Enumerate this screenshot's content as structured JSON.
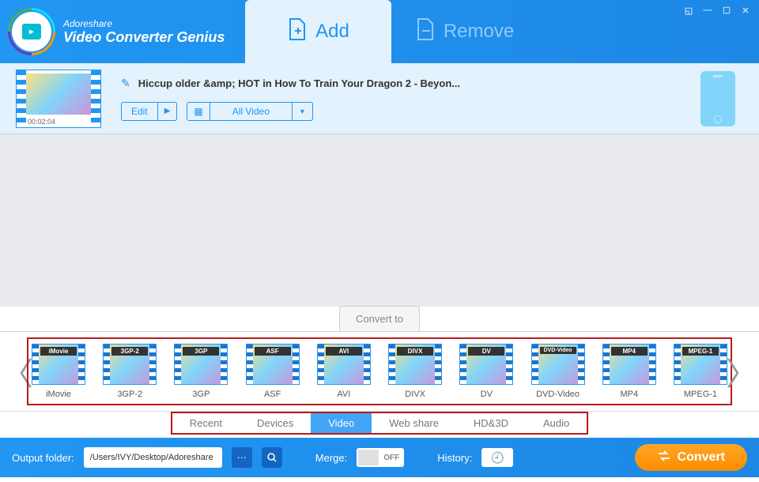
{
  "brand": {
    "name": "Adoreshare",
    "product": "Video Converter Genius"
  },
  "header": {
    "add_label": "Add",
    "remove_label": "Remove"
  },
  "file": {
    "title": "Hiccup  older &amp; HOT in How To Train Your Dragon 2 - Beyon...",
    "edit_label": "Edit",
    "dropdown_label": "All Video",
    "timestamp": "00:02:04"
  },
  "convert_to_label": "Convert to",
  "formats": [
    {
      "badge": "iMovie",
      "label": "iMovie"
    },
    {
      "badge": "3GP-2",
      "label": "3GP-2"
    },
    {
      "badge": "3GP",
      "label": "3GP"
    },
    {
      "badge": "ASF",
      "label": "ASF"
    },
    {
      "badge": "AVI",
      "label": "AVI"
    },
    {
      "badge": "DIVX",
      "label": "DIVX"
    },
    {
      "badge": "DV",
      "label": "DV"
    },
    {
      "badge": "DVD-Video",
      "label": "DVD-Video"
    },
    {
      "badge": "MP4",
      "label": "MP4"
    },
    {
      "badge": "MPEG-1",
      "label": "MPEG-1"
    }
  ],
  "categories": [
    {
      "label": "Recent",
      "active": false
    },
    {
      "label": "Devices",
      "active": false
    },
    {
      "label": "Video",
      "active": true
    },
    {
      "label": "Web share",
      "active": false
    },
    {
      "label": "HD&3D",
      "active": false
    },
    {
      "label": "Audio",
      "active": false
    }
  ],
  "footer": {
    "output_label": "Output folder:",
    "output_path": "/Users/IVY/Desktop/Adoreshare",
    "merge_label": "Merge:",
    "merge_state": "OFF",
    "history_label": "History:",
    "convert_label": "Convert"
  }
}
